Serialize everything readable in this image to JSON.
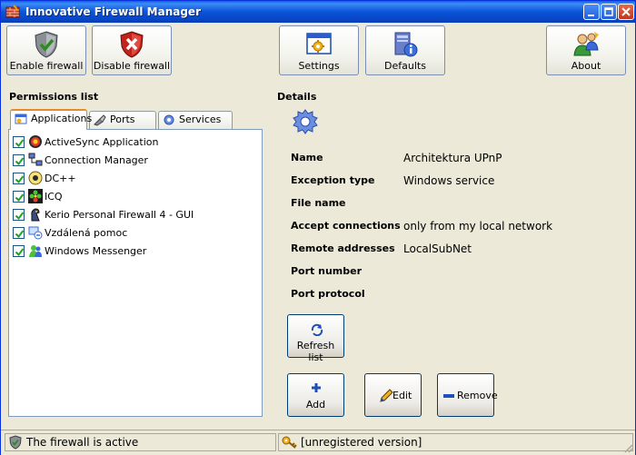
{
  "window": {
    "title": "Innovative Firewall Manager"
  },
  "toolbar": {
    "enable_firewall": "Enable firewall",
    "disable_firewall": "Disable firewall",
    "settings": "Settings",
    "defaults": "Defaults",
    "about": "About"
  },
  "permissions": {
    "title": "Permissions list",
    "tabs": [
      "Applications",
      "Ports",
      "Services"
    ],
    "items": [
      {
        "label": "ActiveSync Application",
        "checked": true
      },
      {
        "label": "Connection Manager",
        "checked": true
      },
      {
        "label": "DC++",
        "checked": true
      },
      {
        "label": "ICQ",
        "checked": true
      },
      {
        "label": "Kerio Personal Firewall 4 - GUI",
        "checked": true
      },
      {
        "label": "Vzdálená pomoc",
        "checked": true
      },
      {
        "label": "Windows Messenger",
        "checked": true
      }
    ]
  },
  "details": {
    "title": "Details",
    "rows": [
      {
        "label": "Name",
        "value": "Architektura UPnP"
      },
      {
        "label": "Exception type",
        "value": "Windows service"
      },
      {
        "label": "File name",
        "value": ""
      },
      {
        "label": "Accept connections",
        "value": "only from my local network"
      },
      {
        "label": "Remote addresses",
        "value": "LocalSubNet"
      },
      {
        "label": "Port number",
        "value": ""
      },
      {
        "label": "Port protocol",
        "value": ""
      }
    ],
    "refresh_label": "Refresh list",
    "add_label": "Add",
    "edit_label": "Edit",
    "remove_label": "Remove"
  },
  "status": {
    "firewall_state": "The firewall is active",
    "registration": "[unregistered version]"
  }
}
